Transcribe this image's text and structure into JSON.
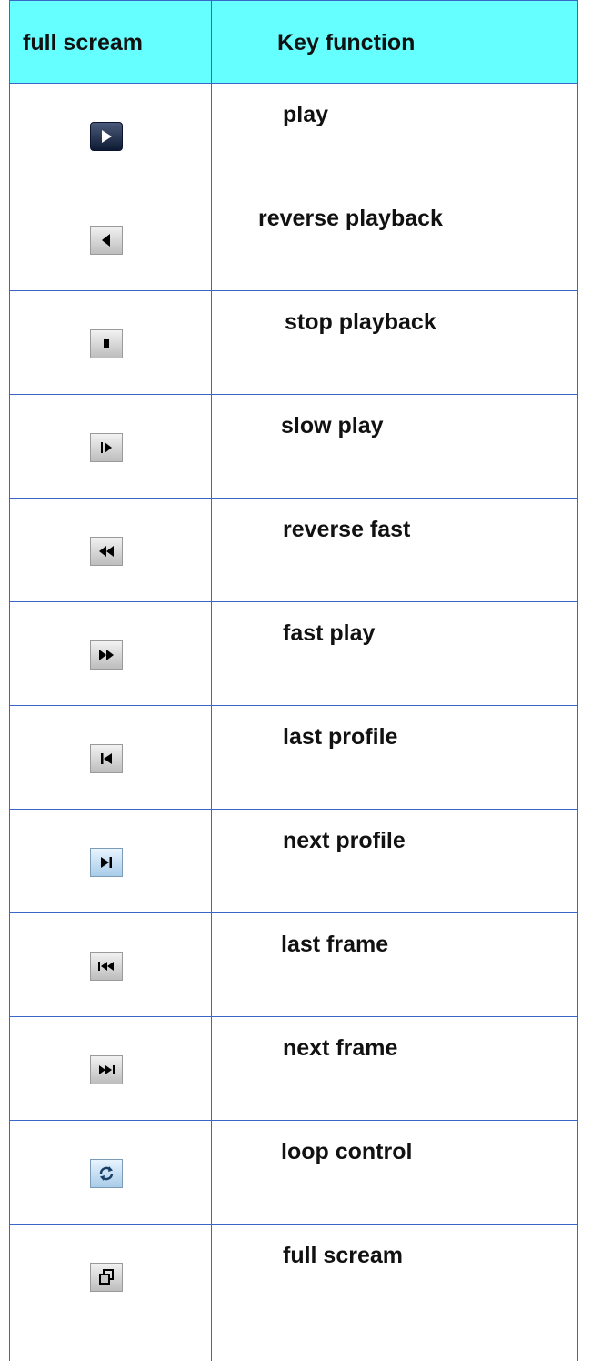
{
  "table": {
    "headers": {
      "col1": "full scream",
      "col2": "Key function"
    },
    "rows": [
      {
        "icon": "play-icon",
        "label": "play"
      },
      {
        "icon": "reverse-playback-icon",
        "label": "reverse playback"
      },
      {
        "icon": "stop-icon",
        "label": "stop playback"
      },
      {
        "icon": "slow-play-icon",
        "label": "slow play"
      },
      {
        "icon": "rewind-icon",
        "label": "reverse fast"
      },
      {
        "icon": "fast-forward-icon",
        "label": "fast play"
      },
      {
        "icon": "previous-icon",
        "label": "last profile"
      },
      {
        "icon": "next-icon",
        "label": "next profile"
      },
      {
        "icon": "skip-back-icon",
        "label": "last frame"
      },
      {
        "icon": "skip-forward-icon",
        "label": "next frame"
      },
      {
        "icon": "loop-icon",
        "label": "loop control"
      },
      {
        "icon": "fullscreen-icon",
        "label": "full scream"
      }
    ]
  },
  "colors": {
    "header_bg": "#66ffff",
    "border": "#3a66c8"
  }
}
